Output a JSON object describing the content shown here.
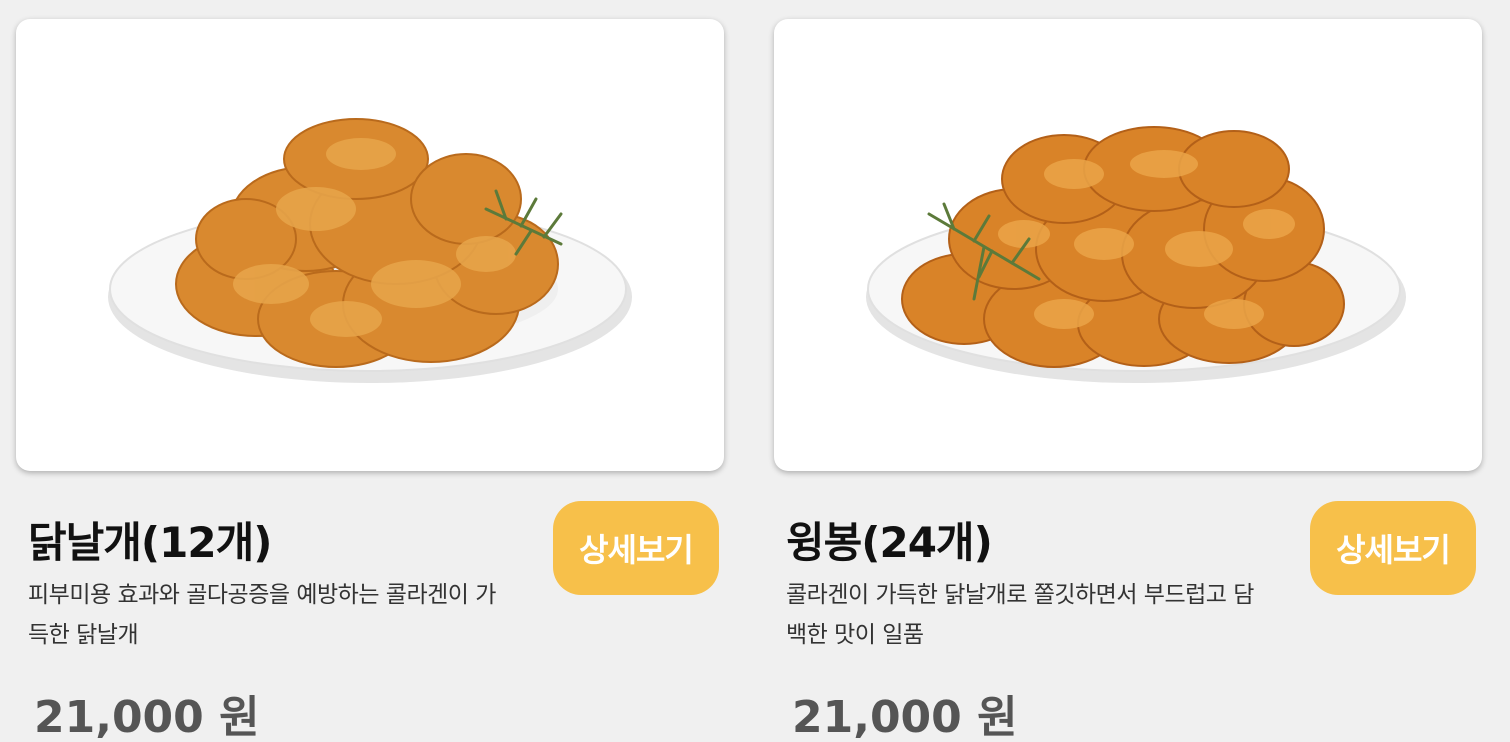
{
  "products": [
    {
      "title": "닭날개(12개)",
      "description": "피부미용 효과와 골다공증을 예방하는 콜라겐이 가득한 닭날개",
      "price": "21,000 원",
      "button_label": "상세보기",
      "image_icon": "fried-chicken-wings-plate"
    },
    {
      "title": "윙봉(24개)",
      "description": "콜라겐이 가득한 닭날개로 쫄깃하면서 부드럽고 담백한 맛이 일품",
      "price": "21,000 원",
      "button_label": "상세보기",
      "image_icon": "fried-chicken-wingette-plate"
    }
  ],
  "colors": {
    "page_background": "#f0f0f0",
    "button_background": "#f7c04a",
    "button_text": "#ffffff",
    "price_text": "#555555"
  }
}
